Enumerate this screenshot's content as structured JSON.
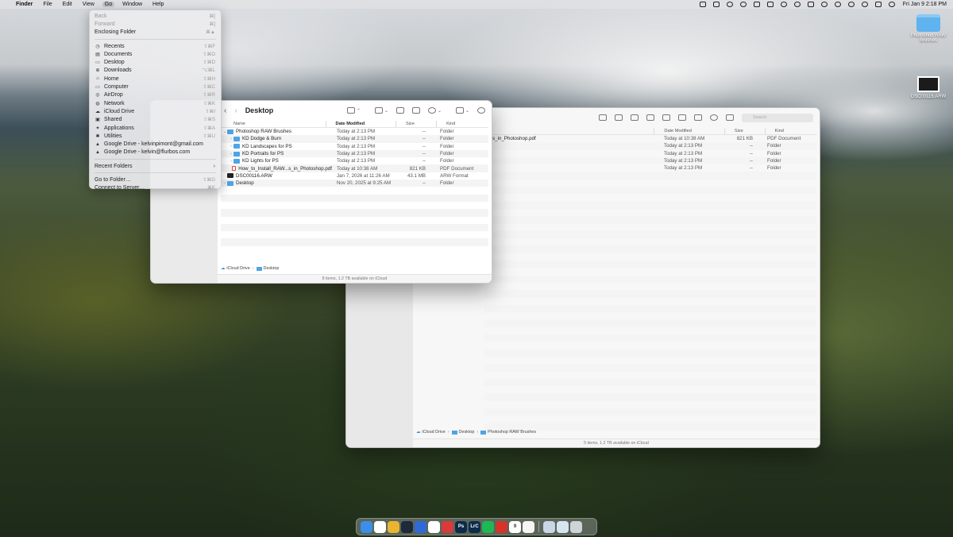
{
  "menubar": {
    "app": "Finder",
    "items": [
      "File",
      "Edit",
      "View",
      "Go",
      "Window",
      "Help"
    ],
    "clock": "Fri Jan 9  2:18 PM"
  },
  "go_menu": {
    "items": [
      {
        "label": "Back",
        "shortcut": "⌘[",
        "disabled": true,
        "icon": ""
      },
      {
        "label": "Forward",
        "shortcut": "⌘]",
        "disabled": true,
        "icon": ""
      },
      {
        "label": "Enclosing Folder",
        "shortcut": "⌘▲",
        "icon": ""
      },
      {
        "sep": true
      },
      {
        "label": "Recents",
        "shortcut": "⇧⌘F",
        "icon": "clock-icon"
      },
      {
        "label": "Documents",
        "shortcut": "⇧⌘O",
        "icon": "document-icon"
      },
      {
        "label": "Desktop",
        "shortcut": "⇧⌘D",
        "icon": "desktop-icon"
      },
      {
        "label": "Downloads",
        "shortcut": "⌥⌘L",
        "icon": "download-icon"
      },
      {
        "label": "Home",
        "shortcut": "⇧⌘H",
        "icon": "home-icon"
      },
      {
        "label": "Computer",
        "shortcut": "⇧⌘C",
        "icon": "computer-icon"
      },
      {
        "label": "AirDrop",
        "shortcut": "⇧⌘R",
        "icon": "airdrop-icon"
      },
      {
        "label": "Network",
        "shortcut": "⇧⌘K",
        "icon": "network-icon"
      },
      {
        "label": "iCloud Drive",
        "shortcut": "⇧⌘I",
        "icon": "icloud-icon"
      },
      {
        "label": "Shared",
        "shortcut": "⇧⌘S",
        "icon": "shared-icon"
      },
      {
        "label": "Applications",
        "shortcut": "⇧⌘A",
        "icon": "applications-icon"
      },
      {
        "label": "Utilities",
        "shortcut": "⇧⌘U",
        "icon": "utilities-icon"
      },
      {
        "label": "Google Drive - kelvinpimont@gmail.com",
        "shortcut": "",
        "icon": "drive-icon"
      },
      {
        "label": "Google Drive - kelvin@flurbos.com",
        "shortcut": "",
        "icon": "drive-icon"
      },
      {
        "sep": true
      },
      {
        "label": "Recent Folders",
        "shortcut": "›",
        "icon": "",
        "submenu": true
      },
      {
        "sep": true
      },
      {
        "label": "Go to Folder…",
        "shortcut": "⇧⌘G",
        "icon": ""
      },
      {
        "label": "Connect to Server…",
        "shortcut": "⌘K",
        "icon": ""
      }
    ]
  },
  "front_window": {
    "title": "Desktop",
    "columns": [
      "Name",
      "Date Modified",
      "Size",
      "Kind"
    ],
    "rows": [
      {
        "name": "Photoshop RAW Brushes",
        "modified": "Today at 2:13 PM",
        "size": "--",
        "kind": "Folder",
        "type": "folder",
        "indent": 0,
        "expanded": true
      },
      {
        "name": "KD Dodge & Burn",
        "modified": "Today at 2:13 PM",
        "size": "--",
        "kind": "Folder",
        "type": "folder",
        "indent": 1,
        "expanded": false
      },
      {
        "name": "KD Landscapes for PS",
        "modified": "Today at 2:13 PM",
        "size": "--",
        "kind": "Folder",
        "type": "folder",
        "indent": 1,
        "expanded": false
      },
      {
        "name": "KD Portraits for PS",
        "modified": "Today at 2:13 PM",
        "size": "--",
        "kind": "Folder",
        "type": "folder",
        "indent": 1,
        "expanded": false
      },
      {
        "name": "KD Lights for PS",
        "modified": "Today at 2:13 PM",
        "size": "--",
        "kind": "Folder",
        "type": "folder",
        "indent": 1,
        "expanded": false
      },
      {
        "name": "How_to_Install_RAW...s_in_Photoshop.pdf",
        "modified": "Today at 10:38 AM",
        "size": "821 KB",
        "kind": "PDF Document",
        "type": "pdf",
        "indent": 1
      },
      {
        "name": "DSC00116.ARW",
        "modified": "Jan 7, 2026 at 11:26 AM",
        "size": "43.1 MB",
        "kind": "ARW Format",
        "type": "raw",
        "indent": 0
      },
      {
        "name": "Desktop",
        "modified": "Nov 20, 2025 at 9:25 AM",
        "size": "--",
        "kind": "Folder",
        "type": "folder",
        "indent": 0,
        "expanded": false
      }
    ],
    "path": [
      "iCloud Drive",
      "Desktop"
    ],
    "status": "8 items, 1.2 TB available on iCloud"
  },
  "back_window": {
    "title": "rushes",
    "search_placeholder": "Search",
    "columns": [
      "Date Modified",
      "Size",
      "Kind"
    ],
    "rows": [
      {
        "name": "s_in_Photoshop.pdf",
        "modified": "Today at 10:38 AM",
        "size": "821 KB",
        "kind": "PDF Document"
      },
      {
        "name": "",
        "modified": "Today at 2:13 PM",
        "size": "--",
        "kind": "Folder"
      },
      {
        "name": "",
        "modified": "Today at 2:13 PM",
        "size": "--",
        "kind": "Folder"
      },
      {
        "name": "",
        "modified": "Today at 2:13 PM",
        "size": "--",
        "kind": "Folder"
      },
      {
        "name": "",
        "modified": "Today at 2:13 PM",
        "size": "--",
        "kind": "Folder"
      }
    ],
    "path": [
      "iCloud Drive",
      "Desktop",
      "Photoshop RAW Brushes"
    ],
    "status": "5 items, 1.2 TB available on iCloud"
  },
  "desktop_icons": [
    {
      "label": "Photoshop RAW Brushes",
      "type": "folder"
    },
    {
      "label": "DSC00116.ARW",
      "type": "raw"
    }
  ],
  "dock": {
    "apps": [
      {
        "name": "finder-icon",
        "color": "#3b8fe8",
        "text": ""
      },
      {
        "name": "calendar-icon",
        "color": "#ffffff",
        "text": ""
      },
      {
        "name": "chrome-icon",
        "color": "#e9b530",
        "text": ""
      },
      {
        "name": "steam-icon",
        "color": "#1c2a3a",
        "text": ""
      },
      {
        "name": "contacts-icon",
        "color": "#2f6bd6",
        "text": ""
      },
      {
        "name": "slack-icon",
        "color": "#ffffff",
        "text": ""
      },
      {
        "name": "creative-cloud-icon",
        "color": "#d93a3a",
        "text": ""
      },
      {
        "name": "photoshop-icon",
        "color": "#0d2a4a",
        "text": "Ps"
      },
      {
        "name": "lightroom-classic-icon",
        "color": "#0e2c4a",
        "text": "LrC"
      },
      {
        "name": "spotify-icon",
        "color": "#1db954",
        "text": ""
      },
      {
        "name": "acrobat-icon",
        "color": "#d6332a",
        "text": ""
      },
      {
        "name": "calendar-date-icon",
        "color": "#ffffff",
        "text": "9"
      },
      {
        "name": "notes-icon",
        "color": "#f5f5f5",
        "text": ""
      },
      {
        "name": "downloads-stack-icon",
        "color": "#c9d6e6",
        "text": ""
      },
      {
        "name": "documents-stack-icon",
        "color": "#d7e4f2",
        "text": ""
      },
      {
        "name": "trash-icon",
        "color": "#d0d3d8",
        "text": ""
      }
    ]
  }
}
